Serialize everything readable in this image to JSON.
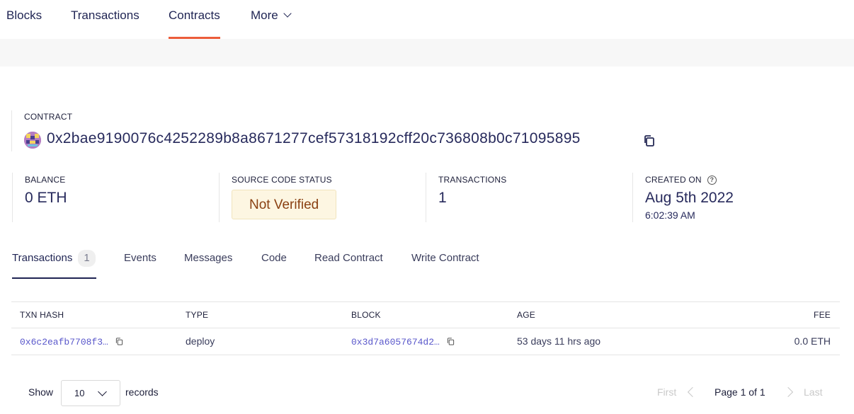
{
  "nav": {
    "items": [
      {
        "label": "Blocks"
      },
      {
        "label": "Transactions"
      },
      {
        "label": "Contracts",
        "active": true
      },
      {
        "label": "More"
      }
    ]
  },
  "contract": {
    "label": "CONTRACT",
    "address": "0x2bae9190076c4252289b8a8671277cef57318192cff20c736808b0c71095895"
  },
  "stats": {
    "balance": {
      "label": "BALANCE",
      "value": "0 ETH"
    },
    "source_code_status": {
      "label": "SOURCE CODE STATUS",
      "value": "Not Verified"
    },
    "transactions": {
      "label": "TRANSACTIONS",
      "value": "1"
    },
    "created_on": {
      "label": "CREATED ON",
      "date": "Aug 5th 2022",
      "time": "6:02:39 AM"
    }
  },
  "tabs": [
    {
      "label": "Transactions",
      "count": "1",
      "active": true
    },
    {
      "label": "Events"
    },
    {
      "label": "Messages"
    },
    {
      "label": "Code"
    },
    {
      "label": "Read Contract"
    },
    {
      "label": "Write Contract"
    }
  ],
  "table": {
    "headers": {
      "txn_hash": "TXN HASH",
      "type": "TYPE",
      "block": "BLOCK",
      "age": "AGE",
      "fee": "FEE"
    },
    "rows": [
      {
        "txn_hash": "0x6c2eafb7708f3…",
        "type": "deploy",
        "block": "0x3d7a6057674d2…",
        "age": "53 days 11 hrs ago",
        "fee": "0.0 ETH"
      }
    ]
  },
  "pagination": {
    "show_label": "Show",
    "page_size": "10",
    "records_label": "records",
    "first": "First",
    "page_info": "Page 1 of 1",
    "last": "Last"
  },
  "colors": {
    "accent": "#ec5c3a",
    "link": "#5957cb",
    "badge_bg": "#fdf6e2",
    "badge_text": "#8a4012"
  }
}
